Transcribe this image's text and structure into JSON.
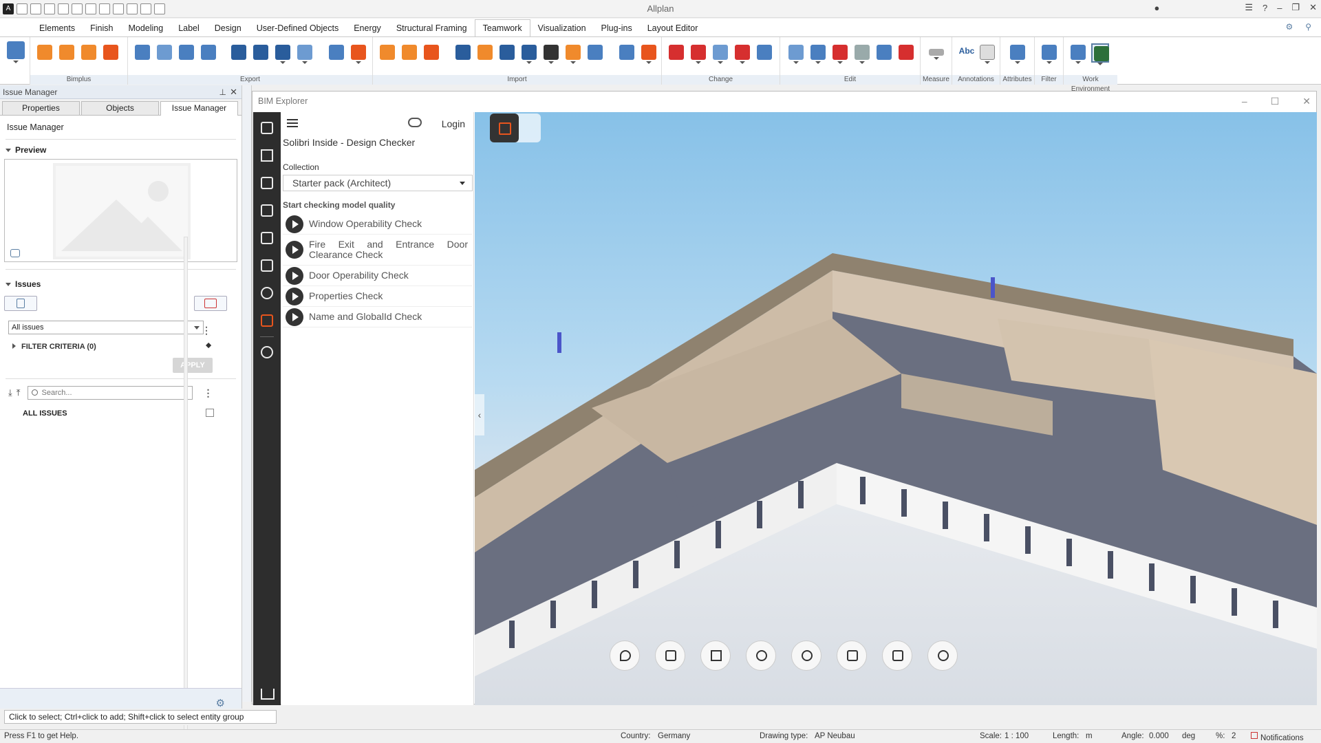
{
  "app": {
    "title": "Allplan"
  },
  "menu": {
    "tabs": [
      "Elements",
      "Finish",
      "Modeling",
      "Label",
      "Design",
      "User-Defined Objects",
      "Energy",
      "Structural Framing",
      "Teamwork",
      "Visualization",
      "Plug-ins",
      "Layout Editor"
    ],
    "active": "Teamwork"
  },
  "ribbon": {
    "groups": [
      "Bimplus",
      "Export",
      "Import",
      "Change",
      "Edit",
      "Measure",
      "Annotations",
      "Attributes",
      "Filter",
      "Work Environment"
    ],
    "annotation_abc": "Abc"
  },
  "left_panel": {
    "header": "Issue Manager",
    "tabs": [
      "Properties",
      "Objects",
      "Issue Manager"
    ],
    "title": "Issue Manager",
    "preview_label": "Preview",
    "issues_label": "Issues",
    "issues_filter_value": "All issues",
    "filter_criteria": "FILTER CRITERIA (0)",
    "apply_label": "APPLY",
    "search_placeholder": "Search...",
    "all_issues_label": "ALL ISSUES"
  },
  "bim_explorer": {
    "title": "BIM Explorer",
    "login_label": "Login",
    "checker_title": "Solibri Inside - Design Checker",
    "collection_label": "Collection",
    "collection_value": "Starter pack (Architect)",
    "start_label": "Start checking model quality",
    "checks": [
      "Window Operability Check",
      "Fire Exit and Entrance Door Clearance Check",
      "Door Operability Check",
      "Properties Check",
      "Name and GlobalId Check"
    ]
  },
  "status": {
    "message": "Click to select; Ctrl+click to add; Shift+click to select entity group",
    "help": "Press F1 to get Help.",
    "country_label": "Country:",
    "country_value": "Germany",
    "drawing_type_label": "Drawing type:",
    "drawing_type_value": "AP Neubau",
    "scale_label": "Scale:",
    "scale_value": "1 : 100",
    "length_label": "Length:",
    "length_value": "m",
    "angle_label": "Angle:",
    "angle_value": "0.000",
    "angle_unit": "deg",
    "percent_label": "%:",
    "percent_value": "2",
    "notifications_label": "Notifications"
  },
  "colors": {
    "accent": "#e8551d",
    "sidebar": "#2d2d2d",
    "ribbon_label_bg": "#e9eff6"
  }
}
